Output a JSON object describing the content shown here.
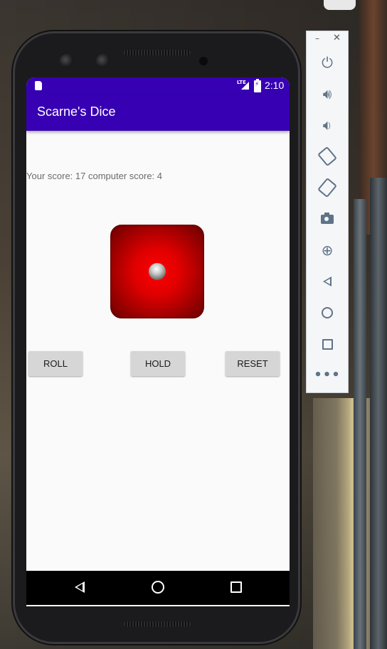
{
  "status_bar": {
    "time": "2:10",
    "network": "LTE"
  },
  "app": {
    "title": "Scarne's Dice",
    "score_text": "Your score: 17 computer score: 4",
    "die": {
      "face_value": 1,
      "color": "#e00000",
      "pip_icon": "die-pip-icon"
    },
    "buttons": {
      "roll": "ROLL",
      "hold": "HOLD",
      "reset": "RESET"
    }
  },
  "nav_bar": {
    "icons": [
      "back-icon",
      "home-icon",
      "recents-icon"
    ]
  },
  "emulator_panel": {
    "icons": [
      "power-icon",
      "volume-up-icon",
      "volume-down-icon",
      "rotate-left-icon",
      "rotate-right-icon",
      "screenshot-camera-icon",
      "zoom-icon",
      "back-icon",
      "home-icon",
      "overview-icon",
      "more-icon"
    ]
  },
  "colors": {
    "primary_dark": "#3700b3",
    "background": "#fafafa",
    "button": "#d6d6d6"
  }
}
